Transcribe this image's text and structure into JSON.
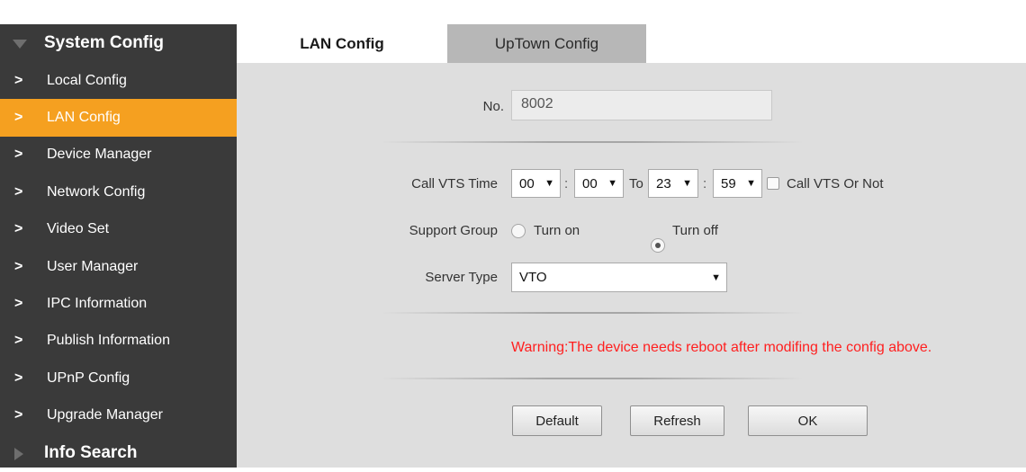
{
  "sidebar": {
    "groups": [
      {
        "label": "System Config",
        "expanded": true
      },
      {
        "label": "Info Search",
        "expanded": false
      }
    ],
    "items": [
      {
        "label": "Local Config"
      },
      {
        "label": "LAN Config",
        "active": true
      },
      {
        "label": "Device Manager"
      },
      {
        "label": "Network Config"
      },
      {
        "label": "Video Set"
      },
      {
        "label": "User Manager"
      },
      {
        "label": "IPC Information"
      },
      {
        "label": "Publish Information"
      },
      {
        "label": "UPnP Config"
      },
      {
        "label": "Upgrade Manager"
      }
    ],
    "chevron": ">",
    "active_color": "#f5a020"
  },
  "tabs": [
    {
      "label": "LAN Config",
      "active": true
    },
    {
      "label": "UpTown Config",
      "active": false
    }
  ],
  "form": {
    "no_label": "No.",
    "no_value": "8002",
    "call_vts_label": "Call VTS Time",
    "start_hour": "00",
    "start_minute": "00",
    "to_label": "To",
    "end_hour": "23",
    "end_minute": "59",
    "colon": ":",
    "call_vts_or_not_label": "Call VTS Or Not",
    "call_vts_or_not_checked": false,
    "support_group_label": "Support Group",
    "support_group_options": [
      {
        "label": "Turn on",
        "selected": false
      },
      {
        "label": "Turn off",
        "selected": true
      }
    ],
    "server_type_label": "Server Type",
    "server_type_value": "VTO",
    "dropdown_arrow": "▼"
  },
  "warning": {
    "text": "Warning:The device needs reboot after modifing the config above.",
    "color": "#ff1f1f"
  },
  "buttons": {
    "default_label": "Default",
    "refresh_label": "Refresh",
    "ok_label": "OK"
  }
}
